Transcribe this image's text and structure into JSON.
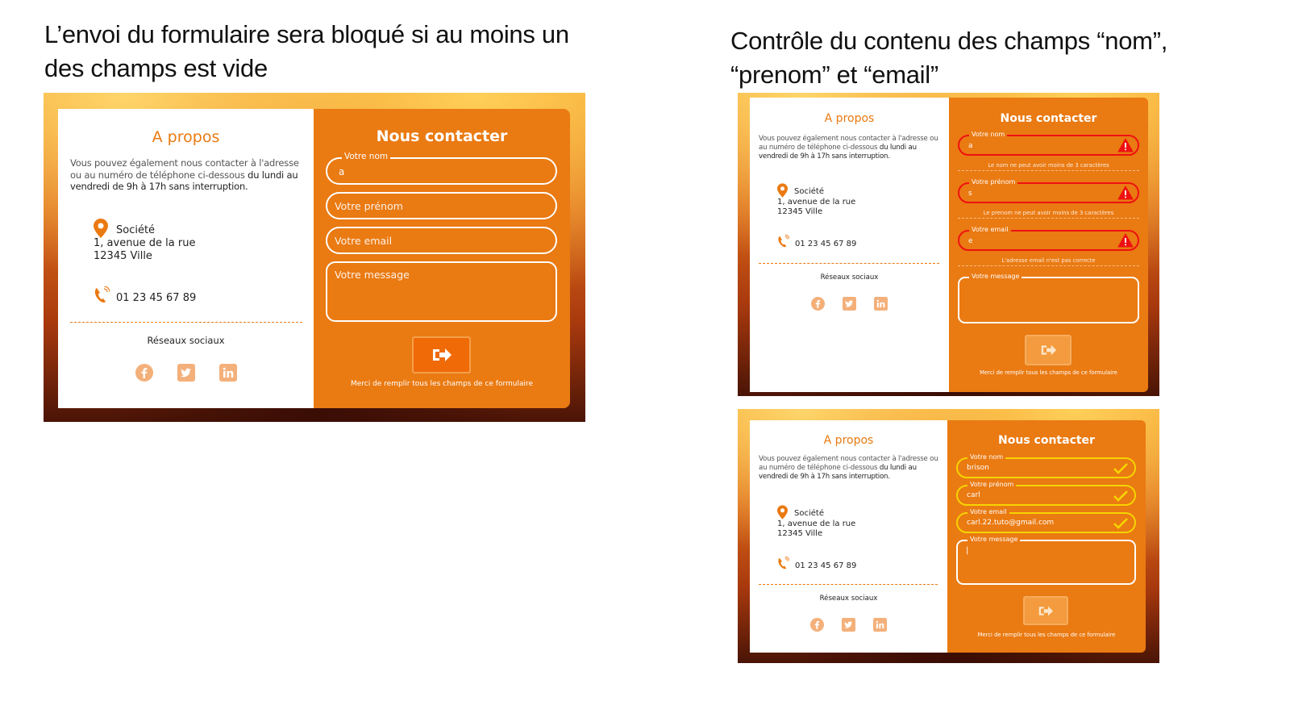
{
  "headings": {
    "left": "L’envoi du formulaire sera bloqué si au moins un des champs est vide",
    "right": "Contrôle du contenu des champs “nom”, “prenom” et “email”"
  },
  "about": {
    "title": "A propos",
    "desc_normal": "Vous pouvez également nous contacter à l'adresse ou au numéro de téléphone ci-dessous",
    "desc_bold": "du lundi au vendredi de 9h à 17h sans interruption.",
    "company": "Société",
    "street": "1, avenue de la rue",
    "city": "12345 Ville",
    "phone": "01 23 45 67 89",
    "social_title": "Réseaux sociaux",
    "icons": [
      "facebook-icon",
      "twitter-icon",
      "linkedin-icon"
    ]
  },
  "contact": {
    "title": "Nous contacter",
    "note": "Merci de remplir tous les champs de ce formulaire",
    "accent": "#ea7a12"
  },
  "screen1": {
    "nom": {
      "legend": "Votre nom",
      "value": "a"
    },
    "prenom": {
      "placeholder": "Votre prénom"
    },
    "email": {
      "placeholder": "Votre email"
    },
    "message": {
      "placeholder": "Votre message"
    }
  },
  "screen2": {
    "nom": {
      "legend": "Votre nom",
      "value": "a",
      "error": "Le nom ne peut avoir moins de 3 caractères"
    },
    "prenom": {
      "legend": "Votre prénom",
      "value": "s",
      "error": "Le prenom ne peut avoir moins de 3 caractères"
    },
    "email": {
      "legend": "Votre email",
      "value": "e",
      "error": "L'adresse email n'est pas correcte"
    },
    "message": {
      "legend": "Votre message"
    }
  },
  "screen3": {
    "nom": {
      "legend": "Votre nom",
      "value": "brison"
    },
    "prenom": {
      "legend": "Votre prénom",
      "value": "carl"
    },
    "email": {
      "legend": "Votre email",
      "value": "carl.22.tuto@gmail.com"
    },
    "message": {
      "legend": "Votre message",
      "value": "|"
    }
  }
}
